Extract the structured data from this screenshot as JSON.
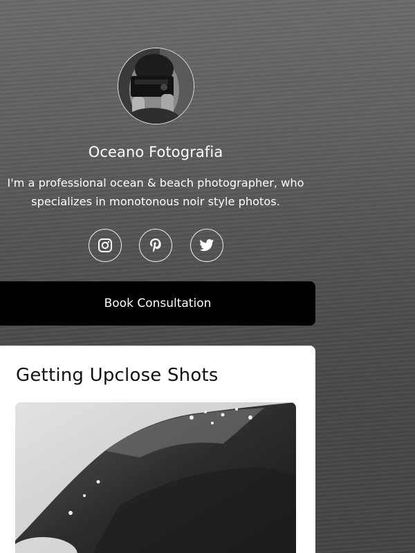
{
  "profile": {
    "name": "Oceano Fotografia",
    "bio": "I'm a professional ocean & beach photographer, who specializes in monotonous noir style photos."
  },
  "social": [
    {
      "icon": "instagram-icon"
    },
    {
      "icon": "pinterest-icon"
    },
    {
      "icon": "twitter-icon"
    }
  ],
  "cta": {
    "label": "Book Consultation"
  },
  "card": {
    "title": "Getting Upclose Shots"
  },
  "colors": {
    "text": "#ffffff",
    "button_bg": "#000000",
    "card_bg": "#ffffff",
    "card_title": "#111111"
  }
}
